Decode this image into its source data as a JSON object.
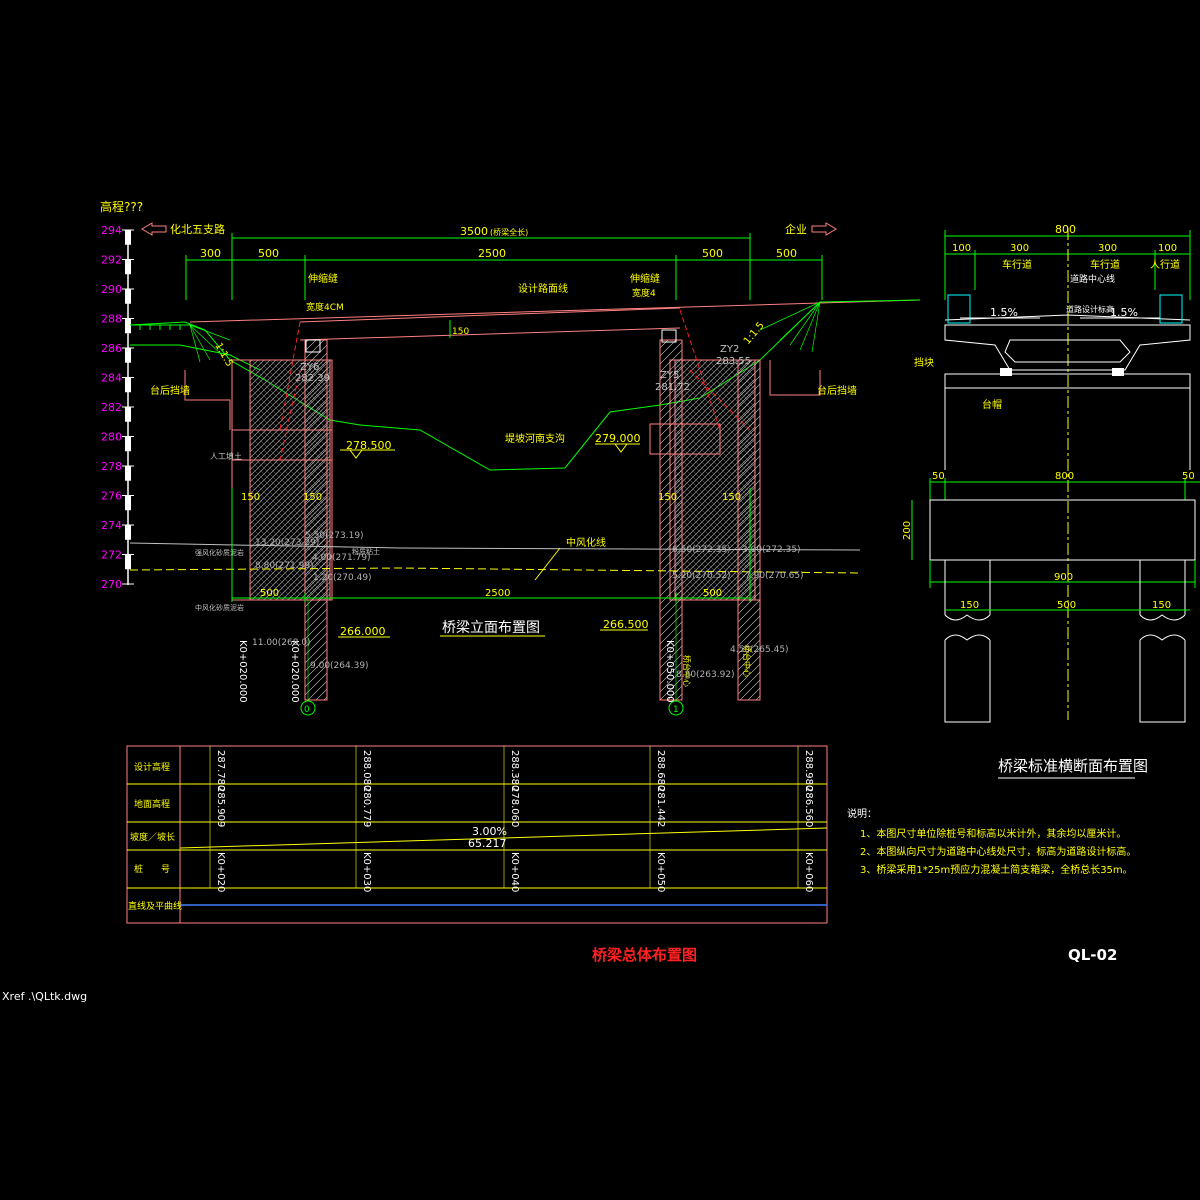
{
  "elevation": {
    "header": "高程???",
    "ticks": [
      "294",
      "292",
      "290",
      "288",
      "286",
      "284",
      "282",
      "280",
      "278",
      "276",
      "274",
      "272",
      "270"
    ]
  },
  "directions": {
    "left": "化北五支路",
    "right": "企业"
  },
  "dims": {
    "total": "3500",
    "total_note": "(桥梁全长)",
    "top_segments": [
      "300",
      "500",
      "2500",
      "500",
      "500"
    ],
    "mid_150": "150",
    "bottom_500_left": "500",
    "bottom_2500": "2500",
    "bottom_500_right": "500",
    "pile_150": [
      "150",
      "150",
      "150",
      "150"
    ]
  },
  "elevation_view": {
    "joint_left": "伸缩缝",
    "joint_left_width": "宽度4CM",
    "joint_right": "伸缩缝",
    "joint_right_width": "宽度4",
    "design_line": "设计路面线",
    "slope_left": "1:1.5",
    "slope_right": "1:1.5",
    "abutment_back_left": "台后挡墙",
    "abutment_back_right": "台后挡墙",
    "zy_left": "ZY6",
    "zy_left_elev": "282.39",
    "zy_mid": "ZY5",
    "zy_mid_elev": "281.72",
    "zy_right": "ZY2",
    "zy_right_elev": "283.55",
    "water_left": "278.500",
    "water_right": "279.000",
    "river": "堤坡河南支沟",
    "fill": "人工填土",
    "weathered": "中风化线",
    "layer1": "强风化砂质泥岩",
    "layer2": "中风化砂质泥岩",
    "layer_fill_mid": "粉质粘土",
    "pile_bottom_left": "266.000",
    "pile_bottom_right": "266.500",
    "title": "桥梁立面布置图",
    "station_left": "K0+020.000",
    "station_right": "K0+050.000",
    "station_left2": "K0+020.000",
    "abut_label": "桥台中心",
    "abut_label2": "桥台中心",
    "axis_left": "0",
    "axis_right": "1",
    "bh_labels": [
      "13.20(273.29)",
      "5.50(273.19)",
      "4.00(271.79)",
      "8.80(271.99)",
      "1.20(270.49)",
      "11.00(268.0)",
      "9.00(264.39)",
      "6.50(272.35)",
      "3.00(272.35)",
      "5.20(270.52)",
      "7.90(270.65)",
      "4.50(265.45)",
      "8.30(263.92)"
    ]
  },
  "cross_section": {
    "total_top": "800",
    "segs": [
      "100",
      "300",
      "300",
      "100"
    ],
    "lanes": [
      "车行道",
      "车行道",
      "人行道"
    ],
    "centerline": "道路中心线",
    "center_mark": "道路设计标高",
    "slope_l": "1.5%",
    "slope_r": "1.5%",
    "wall_label": "挡块",
    "cap_label": "台帽",
    "cap_dims": [
      "50",
      "800",
      "50"
    ],
    "cap_height": "200",
    "cap_bottom": "900",
    "pile_dims": [
      "150",
      "500",
      "150"
    ],
    "title": "桥梁标准横断面布置图"
  },
  "table": {
    "rows": [
      "设计高程",
      "地面高程",
      "坡度／坡长",
      "桩　　号",
      "直线及平曲线"
    ],
    "design_elev": [
      "287.780",
      "288.080",
      "288.380",
      "288.680",
      "288.980"
    ],
    "ground_elev": [
      "285.909",
      "280.779",
      "278.060",
      "281.442",
      "286.560"
    ],
    "grade": "3.00%",
    "grade_len": "65.217",
    "stations": [
      "K0+020",
      "K0+030",
      "K0+040",
      "K0+050",
      "K0+060"
    ]
  },
  "notes": {
    "title": "说明：",
    "items": [
      "1、本图尺寸单位除桩号和标高以米计外，其余均以厘米计。",
      "2、本图纵向尺寸为道路中心线处尺寸，标高为道路设计标高。",
      "3、桥梁采用1*25m预应力混凝土简支箱梁，全桥总长35m。"
    ]
  },
  "sheet_title": "桥梁总体布置图",
  "drawing_no": "QL-02",
  "xref": "Xref .\\QLtk.dwg",
  "colors": {
    "dim": "#00ff00",
    "text": "#ffff00",
    "elev": "#ff00ff",
    "title": "#ff2020",
    "outline": "#ff8080"
  }
}
